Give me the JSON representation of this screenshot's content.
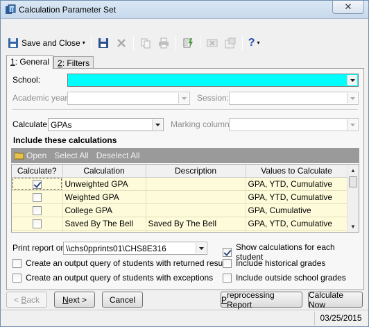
{
  "window": {
    "title": "Calculation Parameter Set",
    "close_glyph": "✕"
  },
  "toolbar": {
    "save_and_close": "Save and Close",
    "help_glyph": "?",
    "dropdown_glyph": "▾"
  },
  "tabs": [
    {
      "key": "1",
      "label": ": General"
    },
    {
      "key": "2",
      "label": ": Filters"
    }
  ],
  "form": {
    "school_label": "School:",
    "school_value": "",
    "academic_year_label": "Academic year:",
    "academic_year_value": "",
    "session_label": "Session:",
    "session_value": "",
    "calculate_label": "Calculate:",
    "calculate_value": "GPAs",
    "marking_column_label": "Marking column:",
    "marking_column_value": "",
    "include_heading": "Include these calculations"
  },
  "grid_toolbar": {
    "open": "Open",
    "select_all": "Select All",
    "deselect_all": "Deselect All"
  },
  "grid": {
    "columns": [
      "Calculate?",
      "Calculation",
      "Description",
      "Values to Calculate"
    ],
    "rows": [
      {
        "checked": true,
        "calculation": "Unweighted GPA",
        "description": "",
        "values": "GPA, YTD, Cumulative"
      },
      {
        "checked": false,
        "calculation": "Weighted GPA",
        "description": "",
        "values": "GPA, YTD, Cumulative"
      },
      {
        "checked": false,
        "calculation": "College GPA",
        "description": "",
        "values": "GPA, Cumulative"
      },
      {
        "checked": false,
        "calculation": "Saved By The Bell",
        "description": "Saved By The Bell",
        "values": "GPA, YTD, Cumulative"
      }
    ]
  },
  "options": {
    "print_report_label": "Print report on",
    "printer_value": "\\\\chs0pprints01\\CHS8E316",
    "show_calcs_label": "Show calculations for each student",
    "show_calcs_checked": true,
    "output_returned_label": "Create an output query of students with returned results",
    "output_returned_checked": false,
    "include_historical_label": "Include historical grades",
    "include_historical_checked": false,
    "output_exceptions_label": "Create an output query of students with exceptions",
    "output_exceptions_checked": false,
    "include_outside_label": "Include outside school grades",
    "include_outside_checked": false
  },
  "buttons": {
    "back_u": "B",
    "back_rest": "ack",
    "back_prefix": "< ",
    "next_u": "N",
    "next_rest": "ext >",
    "cancel": "Cancel",
    "preprocessing_u": "P",
    "preprocessing_rest": "reprocessing Report",
    "calculate_now": "Calculate Now"
  },
  "status": {
    "date": "03/25/2015"
  },
  "colors": {
    "school_field": "#00ffff",
    "grid_row": "#fdfbd9"
  }
}
